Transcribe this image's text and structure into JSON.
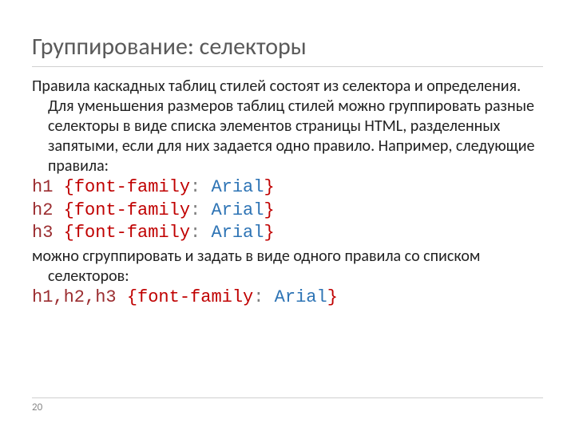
{
  "title": "Группирование: селекторы",
  "para1": "Правила каскадных таблиц стилей состоят из селектора и определения. Для уменьшения размеров таблиц стилей можно группировать разные селекторы в виде списка элементов страницы HTML, разделенных запятыми, если для них задается одно правило. Например, следующие правила:",
  "code": {
    "l1": {
      "sel": "h1",
      "open": " {",
      "prop": "font-family",
      "colon": ":",
      "val": " Arial",
      "close": "}"
    },
    "l2": {
      "sel": "h2",
      "open": " {",
      "prop": "font-family",
      "colon": ":",
      "val": " Arial",
      "close": "}"
    },
    "l3": {
      "sel": "h3",
      "open": " {",
      "prop": "font-family",
      "colon": ":",
      "val": " Arial",
      "close": "}"
    }
  },
  "para2": "можно сгруппировать и задать в виде одного правила со списком селекторов:",
  "code4": {
    "sel": "h1,h2,h3",
    "open": " {",
    "prop": "font-family",
    "colon": ":",
    "val": " Arial",
    "close": "}"
  },
  "page_number": "20"
}
